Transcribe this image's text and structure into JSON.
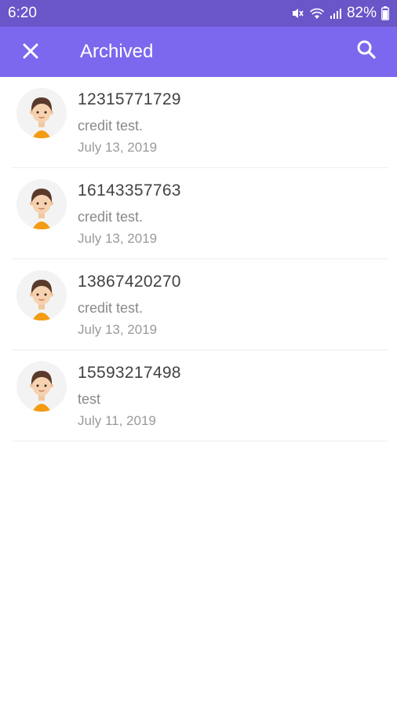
{
  "status_bar": {
    "time": "6:20",
    "battery": "82%",
    "icons": [
      "mute-icon",
      "wifi-icon",
      "signal-icon",
      "battery-icon"
    ]
  },
  "app_bar": {
    "title": "Archived",
    "close_icon": "close-icon",
    "search_icon": "search-icon",
    "color": "#7b68ee"
  },
  "conversations": [
    {
      "number": "12315771729",
      "preview": "credit test.",
      "date": "July 13, 2019"
    },
    {
      "number": "16143357763",
      "preview": "credit test.",
      "date": "July 13, 2019"
    },
    {
      "number": "13867420270",
      "preview": "credit test.",
      "date": "July 13, 2019"
    },
    {
      "number": "15593217498",
      "preview": "test",
      "date": "July 11, 2019"
    }
  ]
}
